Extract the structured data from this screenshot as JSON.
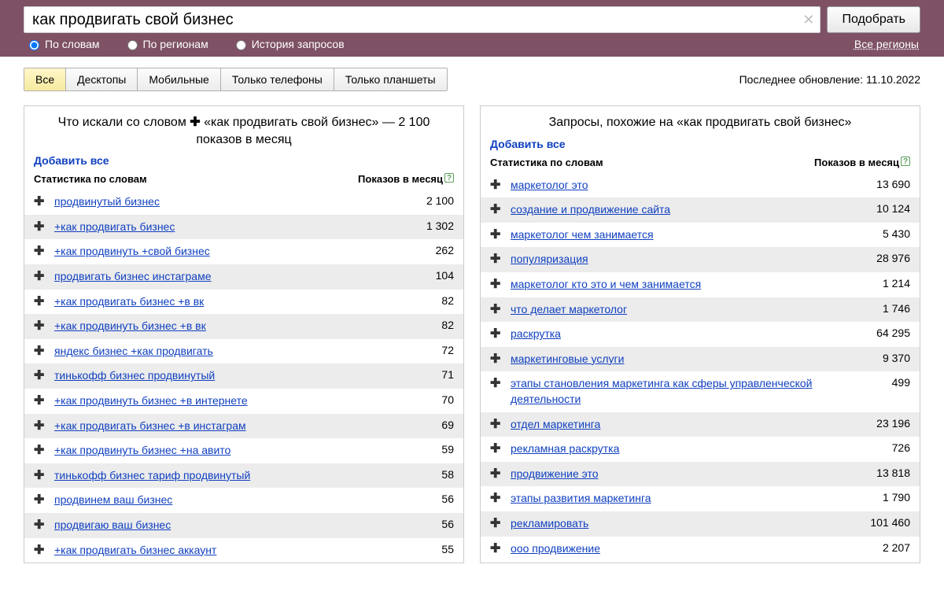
{
  "search": {
    "value": "как продвигать свой бизнес",
    "submit_label": "Подобрать"
  },
  "modes": {
    "by_words": "По словам",
    "by_regions": "По регионам",
    "history": "История запросов",
    "selected": "by_words"
  },
  "regions_link": "Все регионы",
  "device_tabs": [
    "Все",
    "Десктопы",
    "Мобильные",
    "Только телефоны",
    "Только планшеты"
  ],
  "device_tab_selected": 0,
  "last_update_label": "Последнее обновление: 11.10.2022",
  "left_panel": {
    "title_prefix": "Что искали со словом",
    "title_query": "«как продвигать свой бизнес»",
    "title_suffix": "— 2 100 показов в месяц",
    "add_all": "Добавить все",
    "col1": "Статистика по словам",
    "col2": "Показов в месяц",
    "rows": [
      {
        "kw": "продвинутый бизнес",
        "n": "2 100"
      },
      {
        "kw": "+как продвигать бизнес",
        "n": "1 302"
      },
      {
        "kw": "+как продвинуть +свой бизнес",
        "n": "262"
      },
      {
        "kw": "продвигать бизнес инстаграме",
        "n": "104"
      },
      {
        "kw": "+как продвигать бизнес +в вк",
        "n": "82"
      },
      {
        "kw": "+как продвинуть бизнес +в вк",
        "n": "82"
      },
      {
        "kw": "яндекс бизнес +как продвигать",
        "n": "72"
      },
      {
        "kw": "тинькофф бизнес продвинутый",
        "n": "71"
      },
      {
        "kw": "+как продвинуть бизнес +в интернете",
        "n": "70"
      },
      {
        "kw": "+как продвигать бизнес +в инстаграм",
        "n": "69"
      },
      {
        "kw": "+как продвинуть бизнес +на авито",
        "n": "59"
      },
      {
        "kw": "тинькофф бизнес тариф продвинутый",
        "n": "58"
      },
      {
        "kw": "продвинем ваш бизнес",
        "n": "56"
      },
      {
        "kw": "продвигаю ваш бизнес",
        "n": "56"
      },
      {
        "kw": "+как продвигать бизнес аккаунт",
        "n": "55"
      }
    ]
  },
  "right_panel": {
    "title": "Запросы, похожие на «как продвигать свой бизнес»",
    "add_all": "Добавить все",
    "col1": "Статистика по словам",
    "col2": "Показов в месяц",
    "rows": [
      {
        "kw": "маркетолог это",
        "n": "13 690"
      },
      {
        "kw": "создание и продвижение сайта",
        "n": "10 124"
      },
      {
        "kw": "маркетолог чем занимается",
        "n": "5 430"
      },
      {
        "kw": "популяризация",
        "n": "28 976"
      },
      {
        "kw": "маркетолог кто это и чем занимается",
        "n": "1 214"
      },
      {
        "kw": "что делает маркетолог",
        "n": "1 746"
      },
      {
        "kw": "раскрутка",
        "n": "64 295"
      },
      {
        "kw": "маркетинговые услуги",
        "n": "9 370"
      },
      {
        "kw": "этапы становления маркетинга как сферы управленческой деятельности",
        "n": "499"
      },
      {
        "kw": "отдел маркетинга",
        "n": "23 196"
      },
      {
        "kw": "рекламная раскрутка",
        "n": "726"
      },
      {
        "kw": "продвижение это",
        "n": "13 818"
      },
      {
        "kw": "этапы развития маркетинга",
        "n": "1 790"
      },
      {
        "kw": "рекламировать",
        "n": "101 460"
      },
      {
        "kw": "ооо продвижение",
        "n": "2 207"
      }
    ]
  }
}
